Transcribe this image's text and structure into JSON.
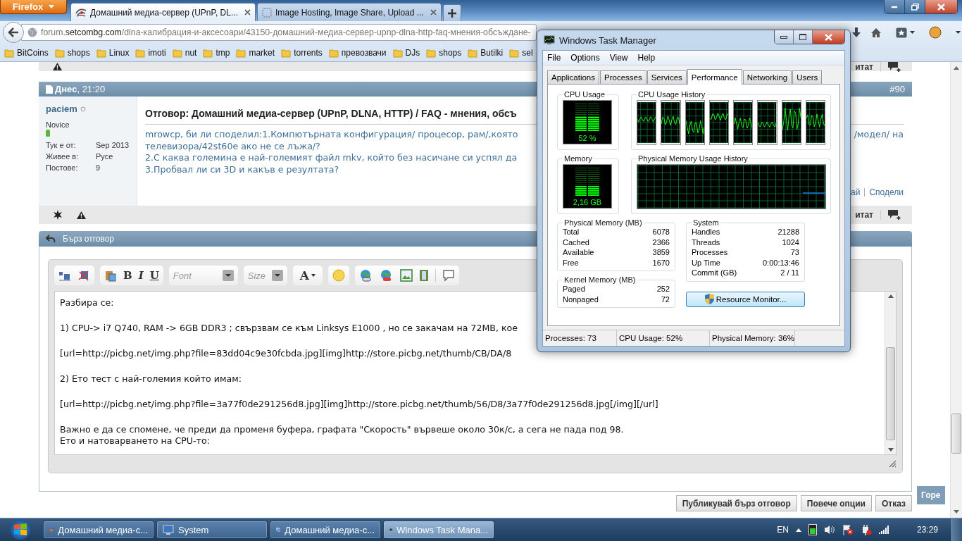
{
  "browser": {
    "menu_button": "Firefox",
    "tabs": [
      {
        "title": "Домашний медиа-сервер (UPnP, DL...",
        "selected": true
      },
      {
        "title": "Image Hosting, Image Share, Upload ...",
        "selected": false
      }
    ],
    "address": {
      "prefix": "forum.",
      "domain": "setcombg.com",
      "path": "/dlna-калибрация-и-аксесоари/43150-домашний-медиа-сервер-upnp-dlna-http-faq-мнения-обсъждане-"
    },
    "bookmarks": [
      "BitCoins",
      "shops",
      "Linux",
      "imoti",
      "nut",
      "tmp",
      "market",
      "torrents",
      "превозвачи",
      "DJs",
      "shops",
      "Butilki",
      "sel"
    ]
  },
  "forum": {
    "prev_post_footer": {
      "quote": "итат"
    },
    "post": {
      "date": "**Днес**, 21:20",
      "number": "#90",
      "author": "paciem",
      "rank": "Novice",
      "info": [
        {
          "label": "Тук е от:",
          "value": "Sep 2013"
        },
        {
          "label": "Живее в:",
          "value": "Русе"
        },
        {
          "label": "Постове:",
          "value": "9"
        }
      ],
      "title": "Отговор: Домашний медиа-сервер (UPnP, DLNA, HTTP) / FAQ - мнения, обсъ",
      "lines": [
        "mrowcp, би ли споделил:1.Компютърната конфигурация/ процесор, рам/,която",
        "телевизора/42st60e ако не се лъжа/?",
        "2.С каква големина е най-големият файл mkv, който без насичане си успял да",
        "3.Пробвал ли си 3D и какъв е резултата?"
      ],
      "line_tail": "/модел/ на",
      "links": [
        "ай",
        "Сподели"
      ],
      "quote": "итат"
    },
    "quick_reply": {
      "title": "Бърз отговор",
      "toolbar": {
        "bold": "B",
        "italic": "I",
        "underline": "U",
        "font": "Font",
        "size": "Size",
        "text_color_button": "A"
      },
      "paragraphs": [
        [
          "Разбира се:"
        ],
        [
          "1) CPU-> i7 Q740, RAM -> 6GB DDR3 ; свързвам се към Linksys E1000 , но се закачам на 72MB, кое"
        ],
        [
          "[url=http://picbg.net/img.php?file=83dd04c9e30fcbda.jpg][img]http://store.picbg.net/thumb/CB/DA/8"
        ],
        [
          "2) Ето тест с най-големия който имам:"
        ],
        [
          "[url=http://picbg.net/img.php?file=3a77f0de291256d8.jpg][img]http://store.picbg.net/thumb/56/D8/3a77f0de291256d8.jpg[/img][/url]"
        ],
        [
          "Важно е да се спомене, че преди да променя буфера, графата \"Скорость\" вървеше около 30к/с, а сега не пада под 98.",
          "Ето и натоварването на CPU-то:"
        ]
      ],
      "buttons": [
        "Публикувай бърз отговор",
        "Повече опции",
        "Отказ"
      ]
    },
    "top_button": "Горе"
  },
  "task_manager": {
    "title": "Windows Task Manager",
    "menu": [
      "File",
      "Options",
      "View",
      "Help"
    ],
    "tabs": [
      {
        "label": "Applications",
        "selected": false
      },
      {
        "label": "Processes",
        "selected": false
      },
      {
        "label": "Services",
        "selected": false
      },
      {
        "label": "Performance",
        "selected": true
      },
      {
        "label": "Networking",
        "selected": false
      },
      {
        "label": "Users",
        "selected": false
      }
    ],
    "cpu": {
      "label": "CPU Usage",
      "reading": "52 %",
      "level": 0.52
    },
    "cpu_history": {
      "label": "CPU Usage History"
    },
    "memory": {
      "label": "Memory",
      "reading": "2,16 GB",
      "level": 0.36
    },
    "memory_history": {
      "label": "Physical Memory Usage History"
    },
    "physical_memory": {
      "label": "Physical Memory (MB)",
      "rows": [
        {
          "name": "Total",
          "value": "6078"
        },
        {
          "name": "Cached",
          "value": "2366"
        },
        {
          "name": "Available",
          "value": "3859"
        },
        {
          "name": "Free",
          "value": "1670"
        }
      ]
    },
    "kernel_memory": {
      "label": "Kernel Memory (MB)",
      "rows": [
        {
          "name": "Paged",
          "value": "252"
        },
        {
          "name": "Nonpaged",
          "value": "72"
        }
      ]
    },
    "system": {
      "label": "System",
      "rows": [
        {
          "name": "Handles",
          "value": "21288"
        },
        {
          "name": "Threads",
          "value": "1024"
        },
        {
          "name": "Processes",
          "value": "73"
        },
        {
          "name": "Up Time",
          "value": "0:00:13:46"
        },
        {
          "name": "Commit (GB)",
          "value": "2 / 11"
        }
      ]
    },
    "resource_button": "Resource Monitor...",
    "status": [
      "Processes: 73",
      "CPU Usage: 52%",
      "Physical Memory: 36%"
    ]
  },
  "taskbar": {
    "items": [
      {
        "label": "Домашний медиа-с...",
        "selected": false
      },
      {
        "label": "System",
        "selected": false
      },
      {
        "label": "Домашний медиа-с...",
        "selected": false
      },
      {
        "label": "Windows Task Mana...",
        "selected": true
      }
    ],
    "language": "EN",
    "clock": "23:29"
  }
}
